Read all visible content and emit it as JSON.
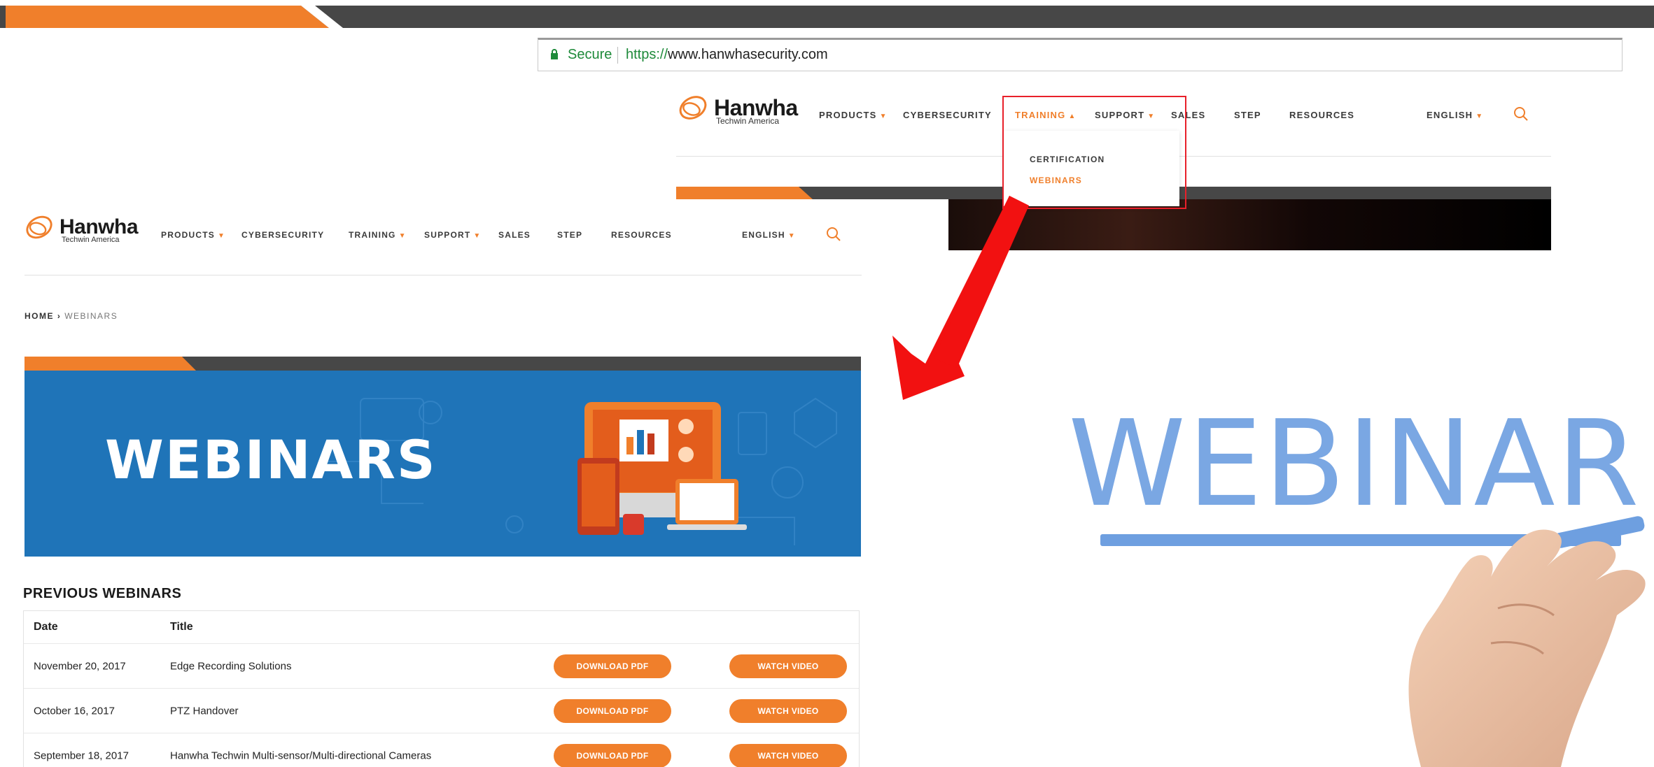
{
  "browser": {
    "secure_label": "Secure",
    "url_scheme": "https://",
    "url_rest": "www.hanwhasecurity.com"
  },
  "logo": {
    "name": "Hanwha",
    "subtitle": "Techwin America"
  },
  "nav_top": {
    "items": [
      "PRODUCTS",
      "CYBERSECURITY",
      "TRAINING",
      "SUPPORT",
      "SALES",
      "STEP",
      "RESOURCES"
    ],
    "language": "ENGLISH",
    "active": "TRAINING"
  },
  "dropdown": {
    "items": [
      "CERTIFICATION",
      "WEBINARS"
    ],
    "active": "WEBINARS"
  },
  "nav_left": {
    "items": [
      "PRODUCTS",
      "CYBERSECURITY",
      "TRAINING",
      "SUPPORT",
      "SALES",
      "STEP",
      "RESOURCES"
    ],
    "language": "ENGLISH"
  },
  "breadcrumb": {
    "home": "HOME",
    "separator": "›",
    "current": "WEBINARS"
  },
  "hero": {
    "title": "WEBINARS"
  },
  "webinars": {
    "section_title": "PREVIOUS WEBINARS",
    "headers": [
      "Date",
      "Title"
    ],
    "download_label": "DOWNLOAD PDF",
    "watch_label": "WATCH VIDEO",
    "rows": [
      {
        "date": "November 20, 2017",
        "title": "Edge Recording Solutions"
      },
      {
        "date": "October 16, 2017",
        "title": "PTZ Handover"
      },
      {
        "date": "September 18, 2017",
        "title": "Hanwha Techwin Multi-sensor/Multi-directional Cameras"
      }
    ]
  },
  "illustration": {
    "word": "WEBINAR"
  },
  "colors": {
    "accent_orange": "#f07f2b",
    "dark_gray": "#474747",
    "highlight_red": "#e8202a",
    "hero_blue": "#1f74b8",
    "webinar_blue": "#7aa7e3"
  }
}
